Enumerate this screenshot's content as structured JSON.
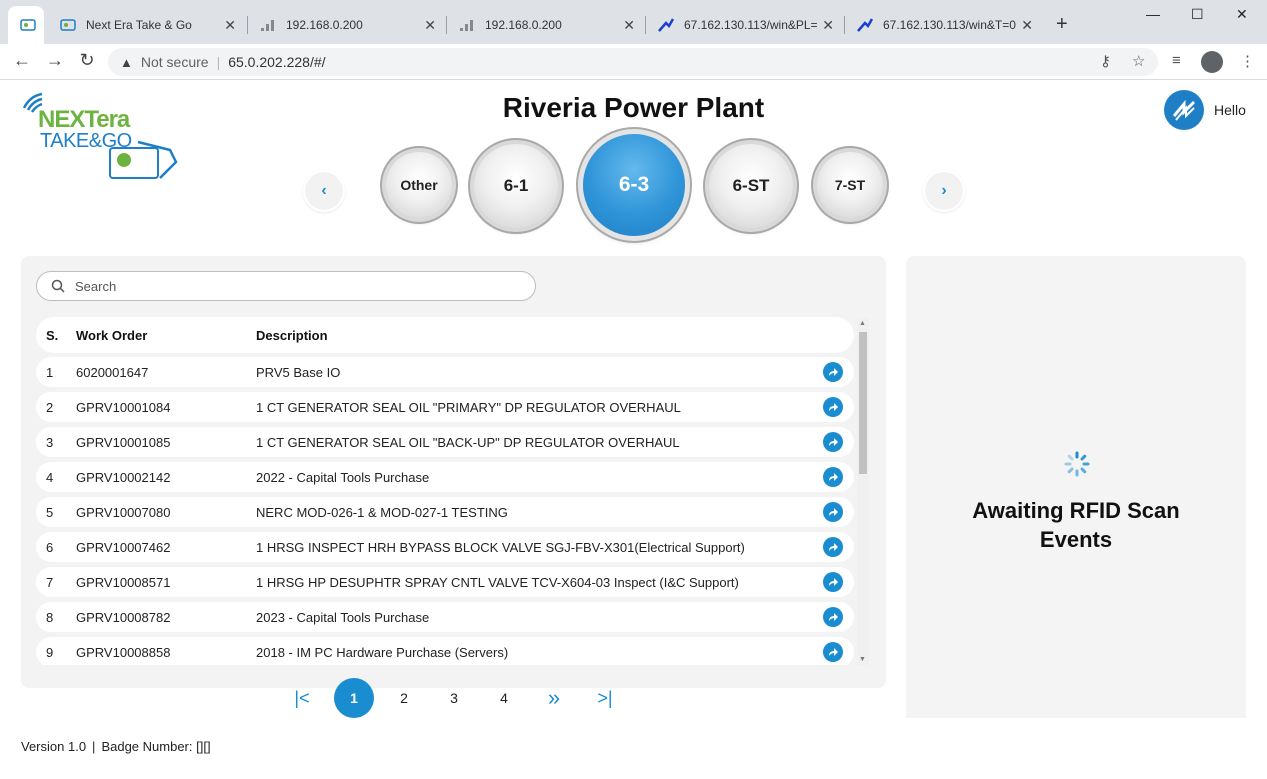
{
  "browser": {
    "tabs": [
      {
        "label": "",
        "icon": "nextera-favicon",
        "active": true
      },
      {
        "label": "Next Era Take & Go",
        "icon": "nextera-favicon"
      },
      {
        "label": "192.168.0.200",
        "icon": "signal-favicon"
      },
      {
        "label": "192.168.0.200",
        "icon": "signal-favicon"
      },
      {
        "label": "67.162.130.113/win&PL=",
        "icon": "wled-favicon"
      },
      {
        "label": "67.162.130.113/win&T=0",
        "icon": "wled-favicon"
      }
    ],
    "security_label": "Not secure",
    "url": "65.0.202.228/#/"
  },
  "header": {
    "logo": {
      "line1": "NEXTera",
      "line2": "TAKE&GO"
    },
    "title": "Riveria Power Plant",
    "greeting": "Hello"
  },
  "units": {
    "items": [
      "Other",
      "6-1",
      "6-3",
      "6-ST",
      "7-ST"
    ],
    "selected": "6-3"
  },
  "search": {
    "placeholder": "Search",
    "value": ""
  },
  "table": {
    "headers": {
      "serial": "S.",
      "work_order": "Work Order",
      "description": "Description"
    },
    "rows": [
      {
        "s": "1",
        "wo": "6020001647",
        "desc": "PRV5 Base IO"
      },
      {
        "s": "2",
        "wo": "GPRV10001084",
        "desc": "1 CT GENERATOR SEAL OIL \"PRIMARY\" DP REGULATOR OVERHAUL"
      },
      {
        "s": "3",
        "wo": "GPRV10001085",
        "desc": "1 CT GENERATOR SEAL OIL \"BACK-UP\" DP REGULATOR OVERHAUL"
      },
      {
        "s": "4",
        "wo": "GPRV10002142",
        "desc": "2022 - Capital Tools Purchase"
      },
      {
        "s": "5",
        "wo": "GPRV10007080",
        "desc": "NERC MOD-026-1 & MOD-027-1 TESTING"
      },
      {
        "s": "6",
        "wo": "GPRV10007462",
        "desc": "1 HRSG INSPECT HRH BYPASS BLOCK VALVE SGJ-FBV-X301(Electrical Support)"
      },
      {
        "s": "7",
        "wo": "GPRV10008571",
        "desc": "1 HRSG HP DESUPHTR SPRAY CNTL VALVE TCV-X604-03 Inspect (I&C Support)"
      },
      {
        "s": "8",
        "wo": "GPRV10008782",
        "desc": "2023 - Capital Tools Purchase"
      },
      {
        "s": "9",
        "wo": "GPRV10008858",
        "desc": "2018 - IM PC Hardware Purchase (Servers)"
      }
    ]
  },
  "pagination": {
    "pages": [
      "1",
      "2",
      "3",
      "4"
    ],
    "current": "1",
    "first": "|<",
    "next": "»",
    "last": ">|"
  },
  "rfid": {
    "line1": "Awaiting RFID Scan",
    "line2": "Events"
  },
  "footer": {
    "version": "Version 1.0",
    "separator": "|",
    "badge_label": "Badge Number:",
    "badge_value": "[][]"
  },
  "colors": {
    "accent": "#1a8dd1",
    "brand_green": "#6db33f",
    "brand_blue": "#1f7fc6"
  }
}
